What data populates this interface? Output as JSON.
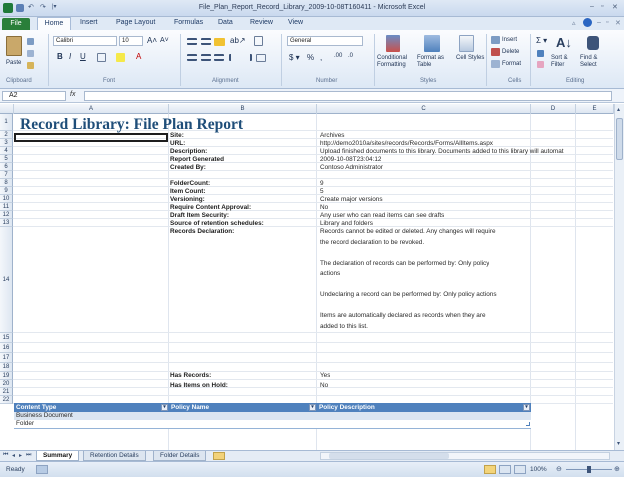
{
  "window": {
    "title": "File_Plan_Report_Record_Library_2009-10-08T160411 - Microsoft Excel",
    "controls": [
      "–",
      "▫",
      "✕"
    ]
  },
  "ribbon": {
    "tabs": [
      "File",
      "Home",
      "Insert",
      "Page Layout",
      "Formulas",
      "Data",
      "Review",
      "View"
    ],
    "active_tab": "Home",
    "clipboard": {
      "paste": "Paste",
      "label": "Clipboard"
    },
    "font": {
      "name": "Calibri",
      "size": "10",
      "label": "Font"
    },
    "alignment": {
      "label": "Alignment"
    },
    "number": {
      "format": "General",
      "label": "Number"
    },
    "styles": {
      "conditional": "Conditional Formatting",
      "format_table": "Format as Table",
      "cell_styles": "Cell Styles",
      "label": "Styles"
    },
    "cells": {
      "insert": "Insert",
      "delete": "Delete",
      "format": "Format",
      "label": "Cells"
    },
    "editing": {
      "sort_filter": "Sort & Filter",
      "find_select": "Find & Select",
      "label": "Editing"
    }
  },
  "formula_bar": {
    "name_box": "A2",
    "fx": "fx",
    "value": ""
  },
  "sheet": {
    "columns": [
      "A",
      "B",
      "C",
      "D",
      "E"
    ],
    "rows": [
      "1",
      "2",
      "3",
      "4",
      "5",
      "6",
      "7",
      "8",
      "9",
      "10",
      "11",
      "12",
      "13",
      "14",
      "15",
      "16",
      "17",
      "18",
      "19",
      "20",
      "21",
      "22"
    ],
    "report_title": "Record Library: File Plan Report",
    "fields": [
      {
        "label": "Site:",
        "value": "Archives"
      },
      {
        "label": "URL:",
        "value": "http://demo2010a/sites/records/Records/Forms/AllItems.aspx"
      },
      {
        "label": "Description:",
        "value": "Upload finished documents to this library. Documents added to this library will automat"
      },
      {
        "label": "Report Generated",
        "value": "2009-10-08T23:04:12"
      },
      {
        "label": "Created By:",
        "value": "Contoso Administrator"
      },
      {
        "label": "FolderCount:",
        "value": "9"
      },
      {
        "label": "Item Count:",
        "value": "5"
      },
      {
        "label": "Versioning:",
        "value": "Create major versions"
      },
      {
        "label": "Require Content Approval:",
        "value": "No"
      },
      {
        "label": "Draft Item Security:",
        "value": "Any user who can read items can see drafts"
      },
      {
        "label": "Source of retention schedules:",
        "value": "Library and folders"
      }
    ],
    "records_declaration": {
      "label": "Records Declaration:",
      "lines": [
        "Records cannot be edited or deleted.  Any changes will require",
        "the record declaration to be revoked.",
        "",
        "The declaration of records can be performed by: Only policy",
        "actions",
        "",
        "Undeclaring a record can be performed by: Only policy actions",
        "",
        "Items are automatically declared as records when they are",
        "added to this list."
      ]
    },
    "has_records": {
      "label": "Has Records:",
      "value": "Yes"
    },
    "has_holds": {
      "label": "Has Items on Hold:",
      "value": "No"
    },
    "table": {
      "headers": [
        "Content Type",
        "Policy Name",
        "Policy Description"
      ],
      "rows": [
        [
          "Business Document",
          "",
          ""
        ],
        [
          "Folder",
          "",
          ""
        ]
      ]
    }
  },
  "sheet_tabs": [
    "Summary",
    "Retention Details",
    "Folder Details"
  ],
  "active_sheet": "Summary",
  "status": {
    "mode": "Ready",
    "zoom": "100%"
  },
  "colors": {
    "title": "#1f4e79",
    "table_header": "#4f81bd",
    "table_band": "#dbe5f1",
    "file_tab": "#2a7f3a"
  }
}
